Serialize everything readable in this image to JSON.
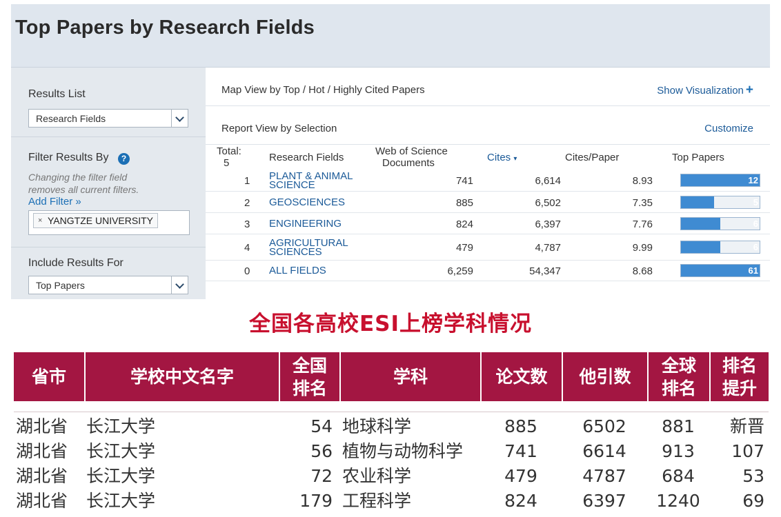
{
  "esi_panel": {
    "title": "Top Papers by Research Fields",
    "sidebar": {
      "results_list_label": "Results List",
      "results_list_value": "Research Fields",
      "filter_label": "Filter Results By",
      "filter_note_line1": "Changing the filter field",
      "filter_note_line2": "removes all current filters.",
      "add_filter": "Add Filter »",
      "filter_chip": "YANGTZE UNIVERSITY",
      "chip_remove": "×",
      "include_label": "Include Results For",
      "include_value": "Top Papers"
    },
    "content": {
      "map_view": "Map View by Top / Hot / Highly Cited Papers",
      "show_visualization": "Show Visualization",
      "plus": "+",
      "report_view": "Report View by Selection",
      "customize": "Customize",
      "table": {
        "headers": {
          "total": "Total:",
          "total_count": "5",
          "field": "Research Fields",
          "docs_line1": "Web of Science",
          "docs_line2": "Documents",
          "cites": "Cites",
          "cites_per_paper": "Cites/Paper",
          "top_papers": "Top Papers"
        },
        "rows": [
          {
            "rank": "1",
            "field_line1": "PLANT & ANIMAL",
            "field_line2": "SCIENCE",
            "docs": "741",
            "cites": "6,614",
            "cpp": "8.93",
            "top_papers": "12",
            "fill_pct": 100
          },
          {
            "rank": "2",
            "field_line1": "GEOSCIENCES",
            "field_line2": "",
            "docs": "885",
            "cites": "6,502",
            "cpp": "7.35",
            "top_papers": "5",
            "fill_pct": 42
          },
          {
            "rank": "3",
            "field_line1": "ENGINEERING",
            "field_line2": "",
            "docs": "824",
            "cites": "6,397",
            "cpp": "7.76",
            "top_papers": "6",
            "fill_pct": 50
          },
          {
            "rank": "4",
            "field_line1": "AGRICULTURAL",
            "field_line2": "SCIENCES",
            "docs": "479",
            "cites": "4,787",
            "cpp": "9.99",
            "top_papers": "6",
            "fill_pct": 50
          },
          {
            "rank": "0",
            "field_line1": "ALL FIELDS",
            "field_line2": "",
            "docs": "6,259",
            "cites": "54,347",
            "cpp": "8.68",
            "top_papers": "61",
            "fill_pct": 100
          }
        ]
      }
    }
  },
  "caption": "全国各高校ESI上榜学科情况",
  "cn_table": {
    "headers": {
      "province": "省市",
      "school": "学校中文名字",
      "national_rank_1": "全国",
      "national_rank_2": "排名",
      "subject": "学科",
      "papers": "论文数",
      "citations": "他引数",
      "global_rank_1": "全球",
      "global_rank_2": "排名",
      "rank_up_1": "排名",
      "rank_up_2": "提升"
    },
    "rows": [
      {
        "province": "湖北省",
        "school": "长江大学",
        "national_rank": "54",
        "subject": "地球科学",
        "papers": "885",
        "citations": "6502",
        "global_rank": "881",
        "rank_up": "新晋"
      },
      {
        "province": "湖北省",
        "school": "长江大学",
        "national_rank": "56",
        "subject": "植物与动物科学",
        "papers": "741",
        "citations": "6614",
        "global_rank": "913",
        "rank_up": "107"
      },
      {
        "province": "湖北省",
        "school": "长江大学",
        "national_rank": "72",
        "subject": "农业科学",
        "papers": "479",
        "citations": "4787",
        "global_rank": "684",
        "rank_up": "53"
      },
      {
        "province": "湖北省",
        "school": "长江大学",
        "national_rank": "179",
        "subject": "工程科学",
        "papers": "824",
        "citations": "6397",
        "global_rank": "1240",
        "rank_up": "69"
      }
    ]
  },
  "colors": {
    "header_band": "#a31642",
    "caption_red": "#c8102e",
    "link_blue": "#1b5a98",
    "bar_blue": "#3f8bd2"
  }
}
